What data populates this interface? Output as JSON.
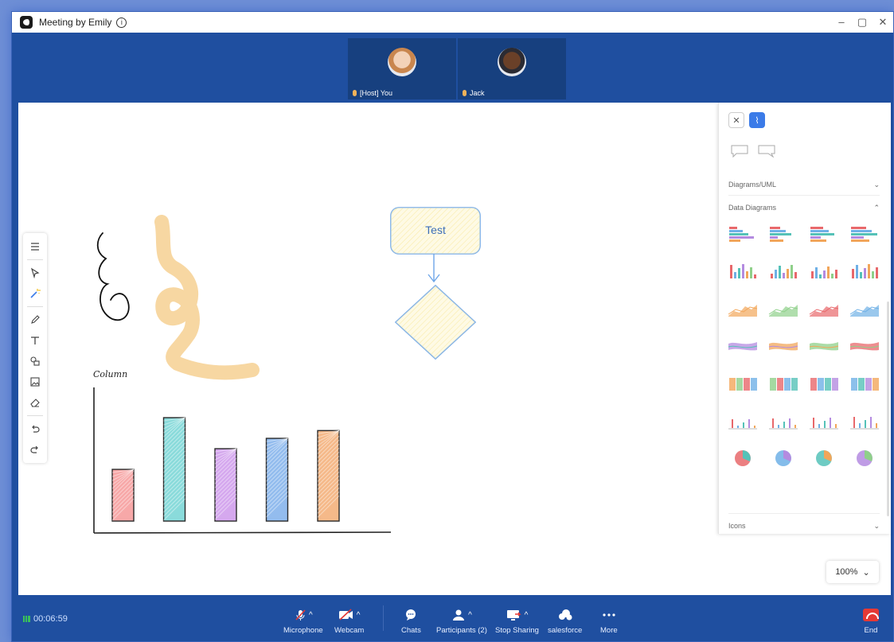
{
  "window": {
    "title": "Meeting by Emily",
    "info_icon": "info-icon",
    "minimize": "–",
    "maximize": "▢",
    "close": "✕"
  },
  "participants": [
    {
      "label": "[Host] You",
      "avatar": "avatar-you"
    },
    {
      "label": "Jack",
      "avatar": "avatar-jack"
    }
  ],
  "whiteboard": {
    "flow_node_text": "Test",
    "chart_title": "Column",
    "zoom": "100%",
    "zoom_chevron": "⌄"
  },
  "chart_data": {
    "type": "bar",
    "title": "Column",
    "categories": [
      "",
      "",
      "",
      "",
      ""
    ],
    "values": [
      2,
      4,
      2.8,
      3.2,
      3.5
    ],
    "colors": [
      "#f48b8b",
      "#63cfcf",
      "#c78be8",
      "#6fa6e8",
      "#f2a262"
    ],
    "xlabel": "",
    "ylabel": ""
  },
  "tools": [
    "menu-icon",
    "select-icon",
    "magic-wand-icon",
    "pencil-icon",
    "text-icon",
    "shapes-icon",
    "image-icon",
    "eraser-icon",
    "undo-icon",
    "redo-icon"
  ],
  "panel": {
    "close": "✕",
    "sections": [
      {
        "label": "Diagrams/UML",
        "chevron": "⌄"
      },
      {
        "label": "Data Diagrams",
        "chevron": "⌃"
      },
      {
        "label": "Icons",
        "chevron": "⌄"
      }
    ],
    "thumb_count": 28
  },
  "bottom": {
    "timer": "00:06:59",
    "controls": [
      {
        "label": "Microphone",
        "icon": "microphone-muted-icon",
        "caret": "^"
      },
      {
        "label": "Webcam",
        "icon": "webcam-off-icon",
        "caret": "^"
      },
      {
        "label": "Chats",
        "icon": "chat-icon",
        "caret": ""
      },
      {
        "label": "Participants (2)",
        "icon": "participants-icon",
        "caret": "^"
      },
      {
        "label": "Stop Sharing",
        "icon": "share-screen-icon",
        "caret": "^"
      },
      {
        "label": "salesforce",
        "icon": "salesforce-icon",
        "caret": ""
      },
      {
        "label": "More",
        "icon": "more-icon",
        "caret": ""
      }
    ],
    "end": "End"
  }
}
